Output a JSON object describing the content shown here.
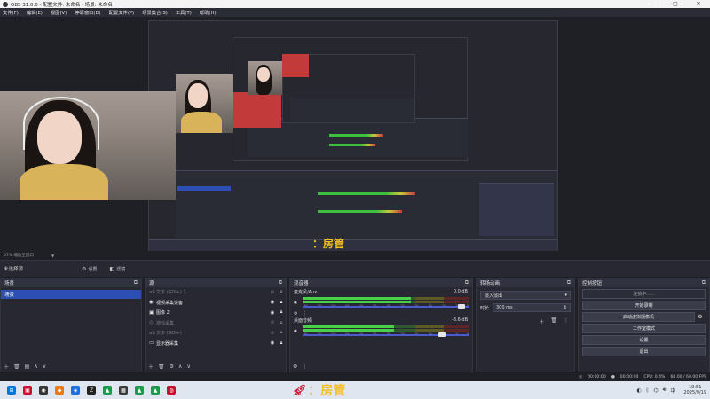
{
  "window": {
    "title": "OBS 31.0.0 - 配置文件: 未命名 - 场景: 未命名",
    "controls": [
      "—",
      "▢",
      "✕"
    ]
  },
  "menu": [
    "文件(F)",
    "编辑(E)",
    "视图(V)",
    "停靠窗口(D)",
    "配置文件(P)",
    "场景集合(S)",
    "工具(T)",
    "帮助(H)"
  ],
  "preview": {
    "logo_text": "：房管",
    "zoom_label": "57%  缩放至窗口"
  },
  "source_toolbar": {
    "no_source": "未选择源",
    "properties": "设置",
    "filters": "滤镜"
  },
  "scenes": {
    "title": "场景",
    "items": [
      "场景"
    ]
  },
  "sources": {
    "title": "源",
    "items": [
      {
        "icon": "text-icon",
        "glyph": "ab",
        "name": "文本 (GDI+) 2",
        "visible": false
      },
      {
        "icon": "camera-icon",
        "glyph": "◉",
        "name": "视频采集设备",
        "visible": true
      },
      {
        "icon": "image-icon",
        "glyph": "▣",
        "name": "图像 2",
        "visible": true
      },
      {
        "icon": "gamepad-icon",
        "glyph": "◎",
        "name": "游戏采集",
        "visible": false
      },
      {
        "icon": "text-icon",
        "glyph": "ab",
        "name": "文本 (GDI+)",
        "visible": false
      },
      {
        "icon": "monitor-icon",
        "glyph": "▭",
        "name": "显示器采集",
        "visible": true
      }
    ]
  },
  "mixer": {
    "title": "混音器",
    "channels": [
      {
        "name": "麦克风/Aux",
        "db": "0.0 dB",
        "level": 0.65,
        "volume": 0.98
      },
      {
        "name": "桌面音频",
        "db": "-3.6 dB",
        "level": 0.55,
        "volume": 0.86
      }
    ],
    "ticks": [
      "-60",
      "-55",
      "-50",
      "-45",
      "-40",
      "-35",
      "-30",
      "-25",
      "-20",
      "-15",
      "-10",
      "-5",
      "0"
    ]
  },
  "transitions": {
    "title": "转场动画",
    "selected": "淡入淡出",
    "duration_label": "时长",
    "duration_value": "300 ms"
  },
  "controls": {
    "title": "控制按钮",
    "connecting": "连接中......",
    "start_recording": "开始录制",
    "start_virtual_cam": "启动虚拟摄像机",
    "studio_mode": "工作室模式",
    "settings": "设置",
    "exit": "退出"
  },
  "status": {
    "stream_time": "00:00:00",
    "rec_time": "00:00:00",
    "cpu": "CPU: 0.4%",
    "fps": "60.00 / 60.00 FPS"
  },
  "taskbar": {
    "logo_text": "：房管",
    "time": "19:51",
    "date": "2025/9/19"
  },
  "colors": {
    "accent": "#2d4fb3",
    "bg": "#1f2026",
    "panel": "#272832"
  }
}
